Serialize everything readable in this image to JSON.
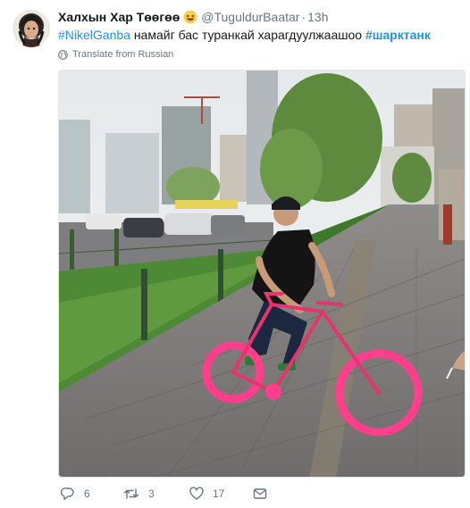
{
  "tweet": {
    "display_name": "Халхын Хар Төөгөө",
    "emoji": "laughing-face-emoji",
    "handle": "@TuguldurBaatar",
    "separator": "·",
    "time": "13h",
    "text": {
      "hashtag1": "#NikelGanba",
      "body": " намайг бас туранкай харагдуулжаашоо ",
      "hashtag2": "#шарктанк"
    },
    "translate_label": "Translate from Russian",
    "photo_description_icon": "photo",
    "actions": {
      "reply_count": "6",
      "retweet_count": "3",
      "like_count": "17"
    },
    "colors": {
      "link": "#1b95e0",
      "meta": "#657786",
      "text": "#14171a"
    }
  }
}
